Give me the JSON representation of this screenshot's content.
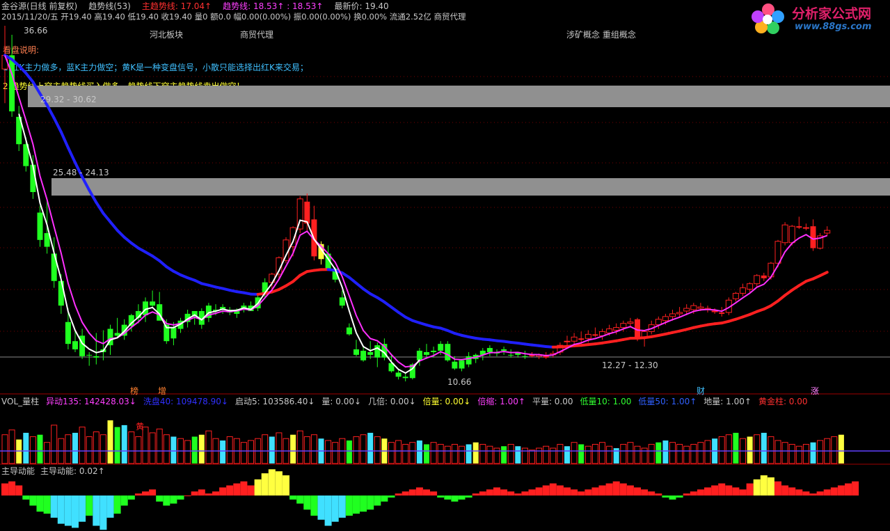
{
  "header": {
    "row1": [
      {
        "text": "金谷源(日线 前复权)",
        "color": "#c8c8c8"
      },
      {
        "text": "趋势线(53)",
        "color": "#c8c8c8"
      },
      {
        "text": "主趋势线: 17.04↑",
        "color": "#ff3030"
      },
      {
        "text": "趋势线: 18.53↑ : 18.53↑",
        "color": "#ff40ff"
      },
      {
        "text": "最新价: 19.40",
        "color": "#c8c8c8"
      }
    ],
    "row2": "2015/11/20/五 开19.40 高19.40 低19.40 收19.40 量0 额0.0 幅0.00(0.00%) 振0.00(0.00%) 换0.00% 流通2.52亿 商贸代理"
  },
  "concepts": [
    "河北板块",
    "商贸代理",
    "涉矿概念 重组概念"
  ],
  "notes": {
    "title": "看盘说明:",
    "line1": "1.红K主力做多，蓝K主力做空；黄K是一种变盘信号，小散只能选择出红K来交易；",
    "line2": "2.趋势线上穿主趋势线买入做多，趋势线下穿主趋势线卖出做空！"
  },
  "price_labels": {
    "high": "36.66",
    "upper_band": "29.32 - 30.62",
    "mid_band": "25.48 - 24.13",
    "low": "10.66",
    "lower_band": "12.27 - 12.30"
  },
  "markers": [
    "榜",
    "增",
    "财",
    "涨"
  ],
  "vol_row": [
    {
      "text": "VOL_量柱",
      "color": "#c8c8c8"
    },
    {
      "text": "异动135: 142428.03↓",
      "color": "#ff40ff"
    },
    {
      "text": "洗盘40: 109478.90↓",
      "color": "#3030ff"
    },
    {
      "text": "启动5: 103586.40↓",
      "color": "#c8c8c8"
    },
    {
      "text": "量: 0.00↓",
      "color": "#c8c8c8"
    },
    {
      "text": "几倍: 0.00↓",
      "color": "#c8c8c8"
    },
    {
      "text": "倍量: 0.00↓",
      "color": "#ffff30"
    },
    {
      "text": "倍缩: 1.00↑",
      "color": "#ff40ff"
    },
    {
      "text": "平量: 0.00",
      "color": "#c8c8c8"
    },
    {
      "text": "低量10: 1.00",
      "color": "#30ff30"
    },
    {
      "text": "低量50: 1.00↑",
      "color": "#3060ff"
    },
    {
      "text": "地量: 1.00↑",
      "color": "#c8c8c8"
    },
    {
      "text": "黄金柱: 0.00",
      "color": "#ff3030"
    }
  ],
  "vol_marker": "黄",
  "power_row": [
    {
      "text": "主导动能",
      "color": "#c8c8c8"
    },
    {
      "text": "主导动能: 0.02↑",
      "color": "#c8c8c8"
    }
  ],
  "logo": {
    "text": "分析家公式网",
    "url": "www.88gs.com"
  },
  "colors": {
    "red": "#ff2020",
    "green": "#20ff20",
    "cyan": "#40e0ff",
    "yellow": "#ffff40",
    "blue": "#2020ff",
    "magenta": "#ff30ff",
    "grey": "#909090"
  },
  "chart_data": {
    "type": "candlestick",
    "candles": [
      [
        33.5,
        36.66,
        31.0,
        34.5
      ],
      [
        34.5,
        36.0,
        30.0,
        30.4
      ],
      [
        30.0,
        30.8,
        27.5,
        28.0
      ],
      [
        28.0,
        28.5,
        26.0,
        26.4
      ],
      [
        26.5,
        27.2,
        24.0,
        24.5
      ],
      [
        23.0,
        23.5,
        20.5,
        21.0
      ],
      [
        21.5,
        24.0,
        20.0,
        20.5
      ],
      [
        20.0,
        21.2,
        17.5,
        18.0
      ],
      [
        18.0,
        18.5,
        15.6,
        16.2
      ],
      [
        15.0,
        16.0,
        13.0,
        13.4
      ],
      [
        13.6,
        14.3,
        12.8,
        13.0
      ],
      [
        14.0,
        14.5,
        12.3,
        12.5
      ],
      [
        12.6,
        12.8,
        11.8,
        12.6
      ],
      [
        12.4,
        14.2,
        11.9,
        12.5
      ],
      [
        12.8,
        14.4,
        12.2,
        13.0
      ],
      [
        13.3,
        14.8,
        12.6,
        14.5
      ],
      [
        14.2,
        15.3,
        13.8,
        14.0
      ],
      [
        14.0,
        15.2,
        13.7,
        14.8
      ],
      [
        14.7,
        15.6,
        14.3,
        15.5
      ],
      [
        15.3,
        16.3,
        14.9,
        15.8
      ],
      [
        15.5,
        16.8,
        15.0,
        16.5
      ],
      [
        16.5,
        17.3,
        16.0,
        16.2
      ],
      [
        16.3,
        17.2,
        15.3,
        15.1
      ],
      [
        14.8,
        15.2,
        13.4,
        13.6
      ],
      [
        13.8,
        15.0,
        13.3,
        14.6
      ],
      [
        14.5,
        15.3,
        14.2,
        15.1
      ],
      [
        15.0,
        15.9,
        14.6,
        15.6
      ],
      [
        15.4,
        15.8,
        14.8,
        15.8
      ],
      [
        15.8,
        16.0,
        14.5,
        14.8
      ],
      [
        15.3,
        16.4,
        15.0,
        16.2
      ],
      [
        15.8,
        16.3,
        15.5,
        15.9
      ],
      [
        15.9,
        16.3,
        15.6,
        16.1
      ],
      [
        15.9,
        16.1,
        15.5,
        15.7
      ],
      [
        15.6,
        16.0,
        15.3,
        15.9
      ],
      [
        16.0,
        16.4,
        15.7,
        16.2
      ],
      [
        16.2,
        16.5,
        15.9,
        15.8
      ],
      [
        16.0,
        17.0,
        15.8,
        16.8
      ],
      [
        17.0,
        18.2,
        16.8,
        17.9
      ],
      [
        17.9,
        18.6,
        17.4,
        18.5
      ],
      [
        18.5,
        19.8,
        18.2,
        19.7
      ],
      [
        19.5,
        21.2,
        19.3,
        21.0
      ],
      [
        20.5,
        22.0,
        19.8,
        21.9
      ],
      [
        21.8,
        24.2,
        21.5,
        24.0
      ],
      [
        23.8,
        24.4,
        21.7,
        22.2
      ],
      [
        22.5,
        23.5,
        19.5,
        19.8
      ],
      [
        20.7,
        20.9,
        19.2,
        19.6
      ],
      [
        20.0,
        20.6,
        18.8,
        18.9
      ],
      [
        18.9,
        19.0,
        17.9,
        18.1
      ],
      [
        16.8,
        17.3,
        16.0,
        16.2
      ],
      [
        14.6,
        14.9,
        14.0,
        14.1
      ],
      [
        13.0,
        13.7,
        12.5,
        12.6
      ],
      [
        12.9,
        13.3,
        12.1,
        12.2
      ],
      [
        12.8,
        13.6,
        12.3,
        12.6
      ],
      [
        12.4,
        13.5,
        11.7,
        13.3
      ],
      [
        13.4,
        13.8,
        12.2,
        12.4
      ],
      [
        12.0,
        12.6,
        11.3,
        11.4
      ],
      [
        11.3,
        11.6,
        10.8,
        11.0
      ],
      [
        10.9,
        11.3,
        10.66,
        11.0
      ],
      [
        10.9,
        12.0,
        10.8,
        11.9
      ],
      [
        12.2,
        13.1,
        11.8,
        12.9
      ],
      [
        12.6,
        13.4,
        12.3,
        12.8
      ],
      [
        12.8,
        13.2,
        12.4,
        12.9
      ],
      [
        12.9,
        13.6,
        12.6,
        13.4
      ],
      [
        13.4,
        13.6,
        12.1,
        12.2
      ],
      [
        12.1,
        12.5,
        11.5,
        11.6
      ],
      [
        11.6,
        12.3,
        11.4,
        12.2
      ],
      [
        11.9,
        12.8,
        11.7,
        12.5
      ],
      [
        12.3,
        12.7,
        12.0,
        12.6
      ],
      [
        12.6,
        13.1,
        12.2,
        12.9
      ],
      [
        12.8,
        13.3,
        12.5,
        13.1
      ],
      [
        12.7,
        13.0,
        12.5,
        12.8
      ],
      [
        12.9,
        13.2,
        12.6,
        13.0
      ],
      [
        12.6,
        13.0,
        12.4,
        12.6
      ],
      [
        12.6,
        12.8,
        12.4,
        12.8
      ],
      [
        12.5,
        12.9,
        12.3,
        12.5
      ],
      [
        12.6,
        12.8,
        12.4,
        12.5
      ],
      [
        12.5,
        12.7,
        12.3,
        12.6
      ],
      [
        12.6,
        12.8,
        12.3,
        12.4
      ],
      [
        12.6,
        12.9,
        12.4,
        12.7
      ],
      [
        12.8,
        13.5,
        12.6,
        13.3
      ],
      [
        13.6,
        14.0,
        13.2,
        13.6
      ],
      [
        13.6,
        14.2,
        13.3,
        13.9
      ],
      [
        13.8,
        14.3,
        13.4,
        13.7
      ],
      [
        13.8,
        14.4,
        13.5,
        14.1
      ],
      [
        14.1,
        14.6,
        13.9,
        14.0
      ],
      [
        14.0,
        14.5,
        13.7,
        14.3
      ],
      [
        14.2,
        14.8,
        14.0,
        14.5
      ],
      [
        14.4,
        14.9,
        14.1,
        14.6
      ],
      [
        14.6,
        15.1,
        14.3,
        14.9
      ],
      [
        14.9,
        15.3,
        14.6,
        15.0
      ],
      [
        15.2,
        15.3,
        13.6,
        13.9
      ],
      [
        13.9,
        14.4,
        13.2,
        14.3
      ],
      [
        14.3,
        15.1,
        14.1,
        14.8
      ],
      [
        14.8,
        15.4,
        14.5,
        15.2
      ],
      [
        15.1,
        15.6,
        14.8,
        15.4
      ],
      [
        15.4,
        15.9,
        15.1,
        15.6
      ],
      [
        15.6,
        16.1,
        15.3,
        15.7
      ],
      [
        15.8,
        16.3,
        15.5,
        16.0
      ],
      [
        15.9,
        16.4,
        15.6,
        16.2
      ],
      [
        16.0,
        16.4,
        15.8,
        16.1
      ],
      [
        15.9,
        16.2,
        15.7,
        16.0
      ],
      [
        15.8,
        16.0,
        15.6,
        15.8
      ],
      [
        15.7,
        16.1,
        15.4,
        15.6
      ],
      [
        15.7,
        16.8,
        15.5,
        16.6
      ],
      [
        16.7,
        17.2,
        16.5,
        17.1
      ],
      [
        17.1,
        17.8,
        16.9,
        17.5
      ],
      [
        17.4,
        17.9,
        17.2,
        17.8
      ],
      [
        17.8,
        18.5,
        17.6,
        18.4
      ],
      [
        18.4,
        18.6,
        18.0,
        18.2
      ],
      [
        18.3,
        19.4,
        18.1,
        19.3
      ],
      [
        19.3,
        21.0,
        19.0,
        20.9
      ],
      [
        20.8,
        22.3,
        20.6,
        22.1
      ],
      [
        20.8,
        22.1,
        20.6,
        22.0
      ],
      [
        22.0,
        22.7,
        21.8,
        21.9
      ],
      [
        21.9,
        22.2,
        21.7,
        21.9
      ],
      [
        22.0,
        22.5,
        20.2,
        20.4
      ],
      [
        20.4,
        21.5,
        20.3,
        21.3
      ],
      [
        21.5,
        22.0,
        21.3,
        21.7
      ]
    ],
    "candle_colors": "rgggggggggggggggggggggggggggggggggggggrrrrrrrygggggggggggggggggggggggggggggrrrrrrrrrrrrrrrrrrrrrrrrrrrrrrrrrrrrrrrrrrrrrrr",
    "volume": [
      30,
      35,
      25,
      32,
      28,
      30,
      22,
      40,
      26,
      30,
      32,
      38,
      28,
      33,
      30,
      45,
      38,
      40,
      33,
      28,
      38,
      32,
      36,
      30,
      28,
      26,
      24,
      28,
      30,
      34,
      26,
      24,
      28,
      26,
      22,
      24,
      26,
      30,
      28,
      32,
      26,
      30,
      34,
      28,
      30,
      26,
      24,
      22,
      26,
      24,
      28,
      30,
      32,
      28,
      26,
      22,
      24,
      20,
      22,
      24,
      20,
      22,
      20,
      18,
      20,
      18,
      20,
      22,
      20,
      18,
      16,
      18,
      20,
      18,
      16,
      14,
      16,
      18,
      16,
      20,
      18,
      22,
      20,
      18,
      20,
      22,
      18,
      16,
      20,
      22,
      18,
      16,
      20,
      22,
      24,
      22,
      20,
      18,
      20,
      22,
      24,
      26,
      28,
      30,
      32,
      26,
      28,
      30,
      32,
      28,
      24,
      22,
      20,
      18,
      20,
      22,
      24,
      26,
      28,
      30
    ],
    "power": [
      12,
      14,
      10,
      -4,
      -10,
      -16,
      -18,
      -22,
      -28,
      -30,
      -32,
      -26,
      -20,
      -30,
      -34,
      -22,
      -18,
      -10,
      -4,
      2,
      4,
      6,
      -6,
      -10,
      -8,
      -4,
      0,
      4,
      6,
      2,
      4,
      8,
      10,
      12,
      14,
      10,
      16,
      22,
      26,
      24,
      20,
      -4,
      -8,
      -14,
      -20,
      -24,
      -30,
      -26,
      -22,
      -20,
      -18,
      -16,
      -14,
      -10,
      -6,
      -2,
      2,
      4,
      6,
      8,
      6,
      4,
      -2,
      -4,
      -6,
      -4,
      -2,
      2,
      4,
      6,
      8,
      6,
      4,
      2,
      4,
      6,
      8,
      10,
      12,
      10,
      8,
      6,
      4,
      6,
      8,
      10,
      12,
      14,
      12,
      10,
      8,
      6,
      4,
      2,
      -2,
      -4,
      -2,
      2,
      4,
      6,
      8,
      10,
      12,
      10,
      8,
      6,
      12,
      16,
      20,
      18,
      14,
      10,
      8,
      6,
      4,
      2,
      4,
      6,
      8,
      10,
      12,
      14
    ]
  }
}
